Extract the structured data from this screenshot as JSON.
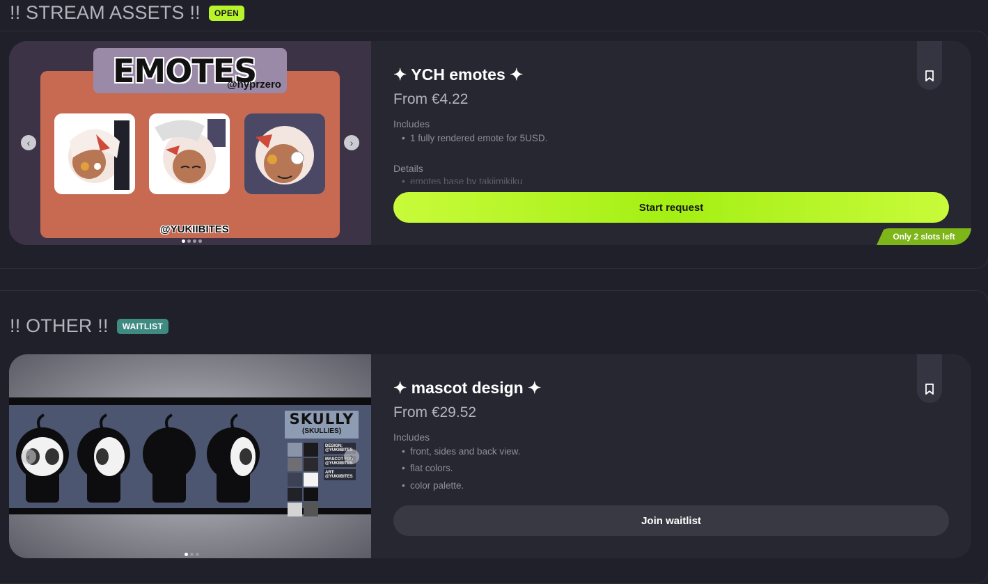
{
  "sections": [
    {
      "title": "!! STREAM ASSETS !!",
      "badge": "OPEN",
      "card": {
        "name": "✦ YCH emotes ✦",
        "price": "From €4.22",
        "includes_label": "Includes",
        "includes": [
          "1 fully rendered emote for 5USD."
        ],
        "details_label": "Details",
        "details_preview": "emotes base by takiimikiku",
        "button": "Start request",
        "slots": "Only 2 slots left",
        "art_title": "EMOTES",
        "art_handle": "@hyprzero",
        "art_credit": "@YUKIIBITES",
        "carousel_total": 4,
        "carousel_current": 1
      }
    },
    {
      "title": "!! OTHER !!",
      "badge": "WAITLIST",
      "card": {
        "name": "✦ mascot design ✦",
        "price": "From €29.52",
        "includes_label": "Includes",
        "includes": [
          "front, sides and back view.",
          "flat colors.",
          "color palette."
        ],
        "button": "Join waitlist",
        "art_title": "SKULLY",
        "art_subtitle": "(SKULLIES)",
        "art_credits": [
          "DESIGN: @YUKIIBITES",
          "MASCOT FOR @YUKIIBITES",
          "ART: @YUKIIBITES"
        ],
        "carousel_total": 3,
        "carousel_current": 1
      }
    }
  ],
  "colors": {
    "background": "#20202a",
    "card": "#272732",
    "accent_green": "#b7f42c",
    "waitlist_teal": "#3f8b82"
  },
  "icons": {
    "bookmark": "bookmark-icon",
    "prev": "chevron-left-icon",
    "next": "chevron-right-icon"
  }
}
